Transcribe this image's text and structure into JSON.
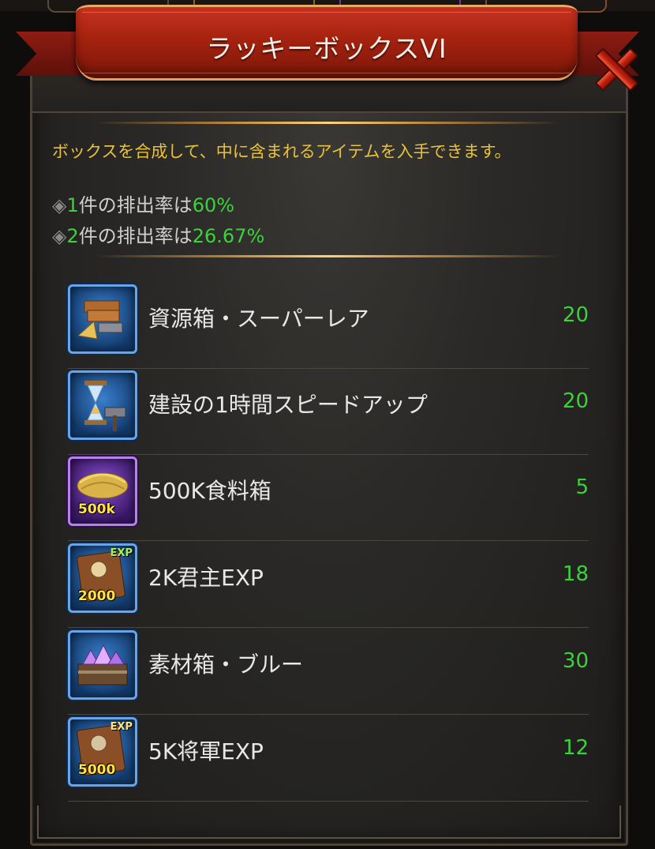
{
  "dialog": {
    "title": "ラッキーボックスVI",
    "description": "ボックスを合成して、中に含まれるアイテムを入手できます。",
    "rates": [
      {
        "count": "1",
        "text": "件の排出率は",
        "percent": "60%"
      },
      {
        "count": "2",
        "text": "件の排出率は",
        "percent": "26.67%"
      }
    ],
    "diamond_glyph": "◈"
  },
  "items": [
    {
      "name": "資源箱・スーパーレア",
      "count": "20",
      "icon": "resource-crate-icon",
      "frame": "blue",
      "badge": ""
    },
    {
      "name": "建設の1時間スピードアップ",
      "count": "20",
      "icon": "hourglass-hammer-icon",
      "frame": "blue",
      "badge": ""
    },
    {
      "name": "500K食料箱",
      "count": "5",
      "icon": "wheat-bundle-icon",
      "frame": "purple",
      "badge": "500k"
    },
    {
      "name": "2K君主EXP",
      "count": "18",
      "icon": "exp-book-icon",
      "frame": "blue",
      "badge": "2000",
      "tag": "EXP"
    },
    {
      "name": "素材箱・ブルー",
      "count": "30",
      "icon": "gem-chest-icon",
      "frame": "blue",
      "badge": ""
    },
    {
      "name": "5K将軍EXP",
      "count": "12",
      "icon": "exp-book-icon",
      "frame": "blue",
      "badge": "5000",
      "tag": "EXP"
    }
  ],
  "colors": {
    "banner": "#b02a16",
    "highlight_green": "#3bd23b",
    "description_yellow": "#e8c23a"
  }
}
